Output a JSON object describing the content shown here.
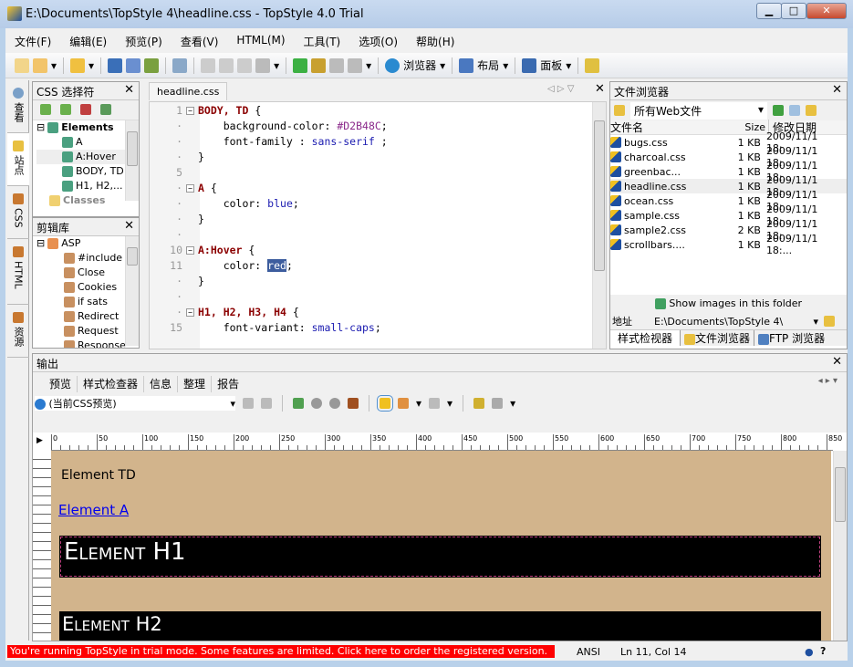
{
  "window": {
    "title": "E:\\Documents\\TopStyle 4\\headline.css - TopStyle 4.0 Trial",
    "min": "▁",
    "max": "□",
    "close": "✕"
  },
  "menu": [
    "文件(F)",
    "编辑(E)",
    "预览(P)",
    "查看(V)",
    "HTML(M)",
    "工具(T)",
    "选项(O)",
    "帮助(H)"
  ],
  "toolbar": {
    "browser_label": "浏览器",
    "layout_label": "布局",
    "panel_label": "面板"
  },
  "vtabs": [
    "查看",
    "站点",
    "CSS",
    "HTML",
    "资源"
  ],
  "css_panel": {
    "title": "CSS 选择符",
    "root": "Elements",
    "items": [
      "A",
      "A:Hover",
      "BODY, TD",
      "H1, H2,..."
    ],
    "classes": "Classes"
  },
  "clip_panel": {
    "title": "剪辑库",
    "root": "ASP",
    "items": [
      "#include",
      "Close",
      "Cookies",
      "if sats",
      "Redirect",
      "Request",
      "Response"
    ]
  },
  "editor": {
    "tab": "headline.css",
    "lines": [
      {
        "n": "1",
        "fold": true,
        "html": "<span class='sel'>BODY, TD</span> {"
      },
      {
        "n": "·",
        "html": "    background-color: <span class='hex'>#D2B48C</span>;"
      },
      {
        "n": "·",
        "html": "    font-family : <span class='val'>sans-serif</span> ;"
      },
      {
        "n": "·",
        "html": "}"
      },
      {
        "n": "5",
        "html": ""
      },
      {
        "n": "·",
        "fold": true,
        "html": "<span class='sel'>A</span> {"
      },
      {
        "n": "·",
        "html": "    color: <span class='val'>blue</span>;"
      },
      {
        "n": "·",
        "html": "}"
      },
      {
        "n": "·",
        "html": ""
      },
      {
        "n": "10",
        "fold": true,
        "html": "<span class='sel'>A:Hover</span> {"
      },
      {
        "n": "11",
        "html": "    color: <span class='hl'>red</span>;"
      },
      {
        "n": "·",
        "html": "}"
      },
      {
        "n": "·",
        "html": ""
      },
      {
        "n": "·",
        "fold": true,
        "html": "<span class='sel'>H1, H2, H3, H4</span> {"
      },
      {
        "n": "15",
        "html": "    font-variant: <span class='val'>small-caps</span>;"
      }
    ]
  },
  "file_browser": {
    "title": "文件浏览器",
    "filter": "所有Web文件",
    "col_name": "文件名",
    "col_size": "Size",
    "col_date": "修改日期",
    "files": [
      {
        "name": "bugs.css",
        "size": "1 KB",
        "date": "2009/11/1 18:..."
      },
      {
        "name": "charcoal.css",
        "size": "1 KB",
        "date": "2009/11/1 18:..."
      },
      {
        "name": "greenbac...",
        "size": "1 KB",
        "date": "2009/11/1 18:..."
      },
      {
        "name": "headline.css",
        "size": "1 KB",
        "date": "2009/11/1 18:..."
      },
      {
        "name": "ocean.css",
        "size": "1 KB",
        "date": "2009/11/1 18:..."
      },
      {
        "name": "sample.css",
        "size": "1 KB",
        "date": "2009/11/1 18:..."
      },
      {
        "name": "sample2.css",
        "size": "2 KB",
        "date": "2009/11/1 18:..."
      },
      {
        "name": "scrollbars....",
        "size": "1 KB",
        "date": "2009/11/1 18:..."
      }
    ],
    "show_images": "Show images in this folder",
    "address_label": "地址",
    "address": "E:\\Documents\\TopStyle 4\\",
    "tabs": [
      "样式检视器",
      "文件浏览器",
      "FTP 浏览器"
    ]
  },
  "output": {
    "title": "输出",
    "tabs": [
      "预览",
      "样式检查器",
      "信息",
      "整理",
      "报告"
    ],
    "preview_select": "(当前CSS预览)",
    "ruler": [
      "0",
      "50",
      "100",
      "150",
      "200",
      "250",
      "300",
      "350",
      "400",
      "450",
      "500",
      "550",
      "600",
      "650",
      "700",
      "750",
      "800",
      "850"
    ],
    "preview": {
      "bg": "#D2B48C",
      "td": "Element TD",
      "a": "Element A",
      "h1": "Element H1",
      "h2": "Element H2"
    }
  },
  "status": {
    "trial": "You're running TopStyle in trial mode. Some features are limited. Click here to order the registered version.",
    "encoding": "ANSI",
    "position": "Ln 11, Col 14",
    "help": "?"
  }
}
